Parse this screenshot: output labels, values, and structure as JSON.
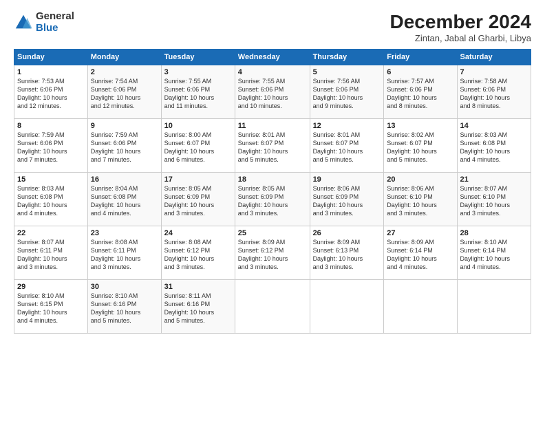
{
  "logo": {
    "general": "General",
    "blue": "Blue"
  },
  "title": "December 2024",
  "subtitle": "Zintan, Jabal al Gharbi, Libya",
  "weekdays": [
    "Sunday",
    "Monday",
    "Tuesday",
    "Wednesday",
    "Thursday",
    "Friday",
    "Saturday"
  ],
  "weeks": [
    [
      {
        "day": "1",
        "info": "Sunrise: 7:53 AM\nSunset: 6:06 PM\nDaylight: 10 hours\nand 12 minutes."
      },
      {
        "day": "2",
        "info": "Sunrise: 7:54 AM\nSunset: 6:06 PM\nDaylight: 10 hours\nand 12 minutes."
      },
      {
        "day": "3",
        "info": "Sunrise: 7:55 AM\nSunset: 6:06 PM\nDaylight: 10 hours\nand 11 minutes."
      },
      {
        "day": "4",
        "info": "Sunrise: 7:55 AM\nSunset: 6:06 PM\nDaylight: 10 hours\nand 10 minutes."
      },
      {
        "day": "5",
        "info": "Sunrise: 7:56 AM\nSunset: 6:06 PM\nDaylight: 10 hours\nand 9 minutes."
      },
      {
        "day": "6",
        "info": "Sunrise: 7:57 AM\nSunset: 6:06 PM\nDaylight: 10 hours\nand 8 minutes."
      },
      {
        "day": "7",
        "info": "Sunrise: 7:58 AM\nSunset: 6:06 PM\nDaylight: 10 hours\nand 8 minutes."
      }
    ],
    [
      {
        "day": "8",
        "info": "Sunrise: 7:59 AM\nSunset: 6:06 PM\nDaylight: 10 hours\nand 7 minutes."
      },
      {
        "day": "9",
        "info": "Sunrise: 7:59 AM\nSunset: 6:06 PM\nDaylight: 10 hours\nand 7 minutes."
      },
      {
        "day": "10",
        "info": "Sunrise: 8:00 AM\nSunset: 6:07 PM\nDaylight: 10 hours\nand 6 minutes."
      },
      {
        "day": "11",
        "info": "Sunrise: 8:01 AM\nSunset: 6:07 PM\nDaylight: 10 hours\nand 5 minutes."
      },
      {
        "day": "12",
        "info": "Sunrise: 8:01 AM\nSunset: 6:07 PM\nDaylight: 10 hours\nand 5 minutes."
      },
      {
        "day": "13",
        "info": "Sunrise: 8:02 AM\nSunset: 6:07 PM\nDaylight: 10 hours\nand 5 minutes."
      },
      {
        "day": "14",
        "info": "Sunrise: 8:03 AM\nSunset: 6:08 PM\nDaylight: 10 hours\nand 4 minutes."
      }
    ],
    [
      {
        "day": "15",
        "info": "Sunrise: 8:03 AM\nSunset: 6:08 PM\nDaylight: 10 hours\nand 4 minutes."
      },
      {
        "day": "16",
        "info": "Sunrise: 8:04 AM\nSunset: 6:08 PM\nDaylight: 10 hours\nand 4 minutes."
      },
      {
        "day": "17",
        "info": "Sunrise: 8:05 AM\nSunset: 6:09 PM\nDaylight: 10 hours\nand 3 minutes."
      },
      {
        "day": "18",
        "info": "Sunrise: 8:05 AM\nSunset: 6:09 PM\nDaylight: 10 hours\nand 3 minutes."
      },
      {
        "day": "19",
        "info": "Sunrise: 8:06 AM\nSunset: 6:09 PM\nDaylight: 10 hours\nand 3 minutes."
      },
      {
        "day": "20",
        "info": "Sunrise: 8:06 AM\nSunset: 6:10 PM\nDaylight: 10 hours\nand 3 minutes."
      },
      {
        "day": "21",
        "info": "Sunrise: 8:07 AM\nSunset: 6:10 PM\nDaylight: 10 hours\nand 3 minutes."
      }
    ],
    [
      {
        "day": "22",
        "info": "Sunrise: 8:07 AM\nSunset: 6:11 PM\nDaylight: 10 hours\nand 3 minutes."
      },
      {
        "day": "23",
        "info": "Sunrise: 8:08 AM\nSunset: 6:11 PM\nDaylight: 10 hours\nand 3 minutes."
      },
      {
        "day": "24",
        "info": "Sunrise: 8:08 AM\nSunset: 6:12 PM\nDaylight: 10 hours\nand 3 minutes."
      },
      {
        "day": "25",
        "info": "Sunrise: 8:09 AM\nSunset: 6:12 PM\nDaylight: 10 hours\nand 3 minutes."
      },
      {
        "day": "26",
        "info": "Sunrise: 8:09 AM\nSunset: 6:13 PM\nDaylight: 10 hours\nand 3 minutes."
      },
      {
        "day": "27",
        "info": "Sunrise: 8:09 AM\nSunset: 6:14 PM\nDaylight: 10 hours\nand 4 minutes."
      },
      {
        "day": "28",
        "info": "Sunrise: 8:10 AM\nSunset: 6:14 PM\nDaylight: 10 hours\nand 4 minutes."
      }
    ],
    [
      {
        "day": "29",
        "info": "Sunrise: 8:10 AM\nSunset: 6:15 PM\nDaylight: 10 hours\nand 4 minutes."
      },
      {
        "day": "30",
        "info": "Sunrise: 8:10 AM\nSunset: 6:16 PM\nDaylight: 10 hours\nand 5 minutes."
      },
      {
        "day": "31",
        "info": "Sunrise: 8:11 AM\nSunset: 6:16 PM\nDaylight: 10 hours\nand 5 minutes."
      },
      null,
      null,
      null,
      null
    ]
  ]
}
